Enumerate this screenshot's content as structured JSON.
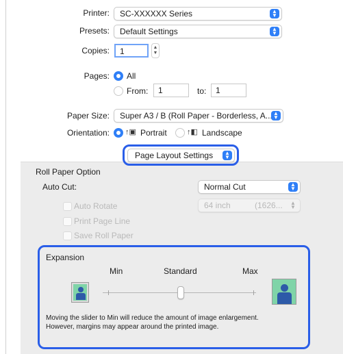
{
  "printer": {
    "label": "Printer:",
    "value": "SC-XXXXXX Series"
  },
  "presets": {
    "label": "Presets:",
    "value": "Default Settings"
  },
  "copies": {
    "label": "Copies:",
    "value": "1"
  },
  "pages": {
    "label": "Pages:",
    "all_label": "All",
    "from_label": "From:",
    "from_value": "1",
    "to_label": "to:",
    "to_value": "1"
  },
  "paper_size": {
    "label": "Paper Size:",
    "value": "Super A3 / B (Roll Paper - Borderless, A..."
  },
  "orientation": {
    "label": "Orientation:",
    "portrait_label": "Portrait",
    "landscape_label": "Landscape"
  },
  "section_popup": {
    "value": "Page Layout Settings"
  },
  "roll_paper": {
    "title": "Roll Paper Option",
    "auto_cut_label": "Auto Cut:",
    "auto_cut_value": "Normal Cut",
    "auto_rotate_label": "Auto Rotate",
    "length_value": "64 inch",
    "length_secondary": "(1626...",
    "print_page_line_label": "Print Page Line",
    "save_roll_paper_label": "Save Roll Paper"
  },
  "expansion": {
    "title": "Expansion",
    "min_label": "Min",
    "standard_label": "Standard",
    "max_label": "Max",
    "slider_value": 0.5,
    "description_line1": "Moving the slider to Min will reduce the amount of image enlargement.",
    "description_line2": "However, margins may appear around the printed image."
  },
  "colors": {
    "accent": "#2f7ff7",
    "highlight": "#2a5ee8",
    "panel_bg": "#ececec"
  }
}
